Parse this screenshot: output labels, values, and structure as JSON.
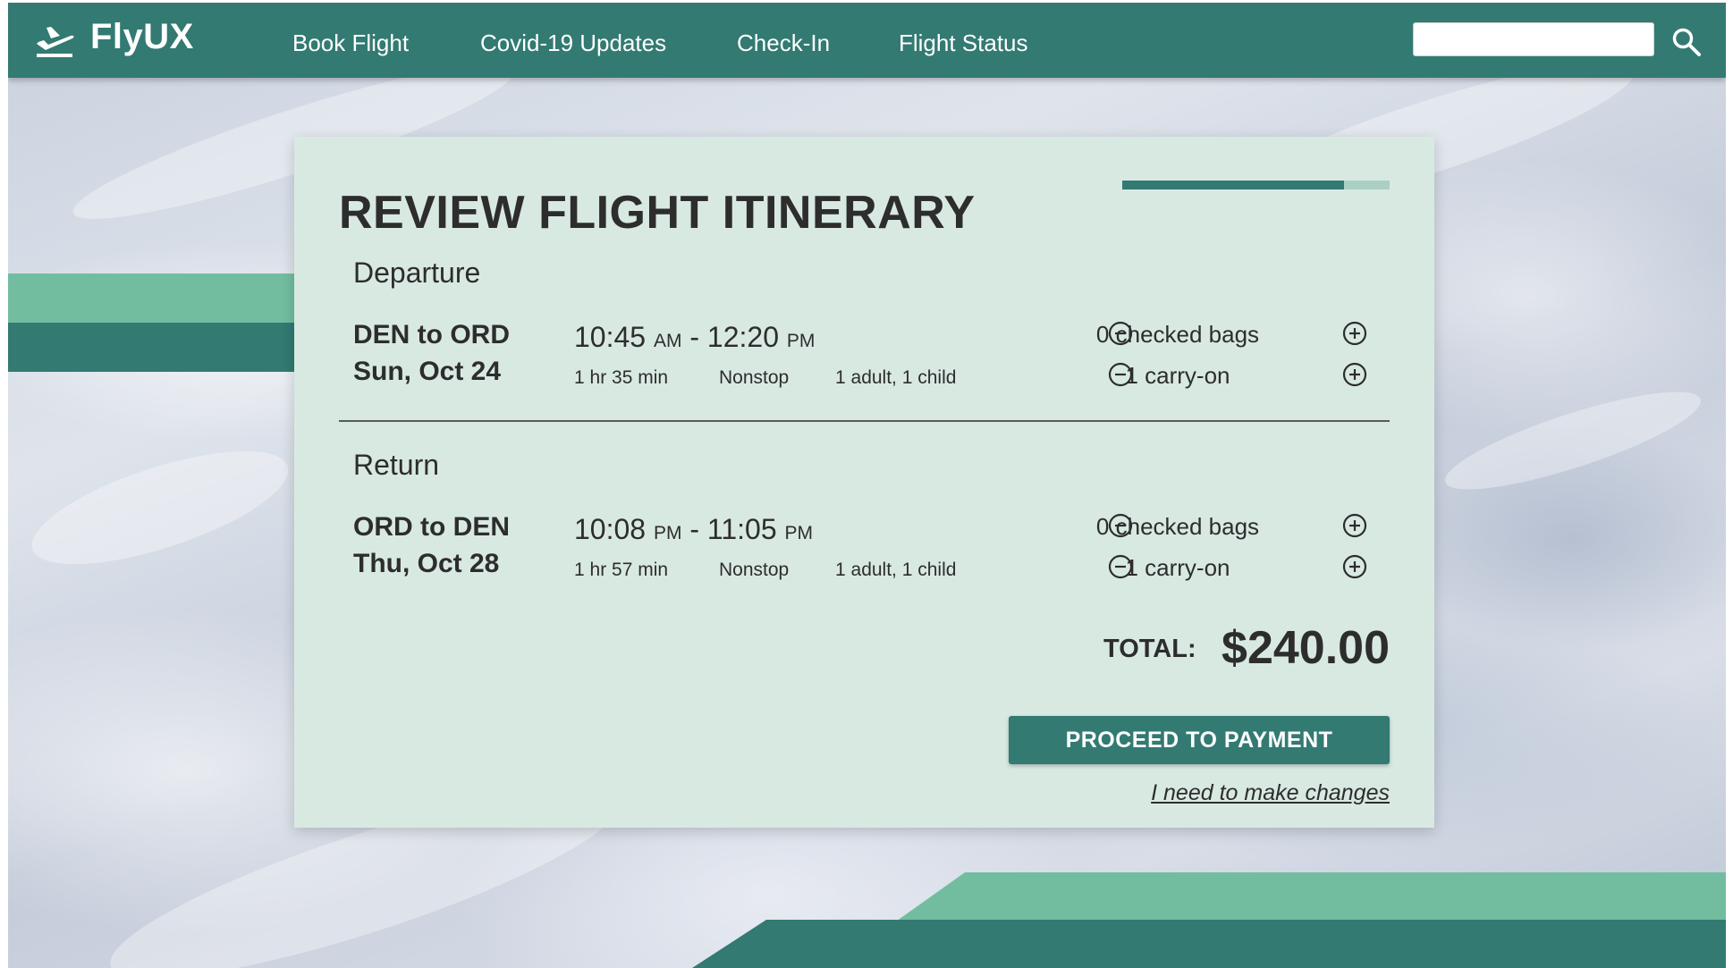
{
  "brand": {
    "name": "FlyUX",
    "icon": "airplane-departure-icon"
  },
  "nav": {
    "links": [
      "Book Flight",
      "Covid-19 Updates",
      "Check-In",
      "Flight Status"
    ],
    "search_value": "",
    "search_icon": "magnifier-icon"
  },
  "colors": {
    "primary": "#327a72",
    "accent": "#72bda0",
    "card_bg": "#d8e9e2",
    "text": "#2d2d2d"
  },
  "itinerary": {
    "title": "REVIEW FLIGHT ITINERARY",
    "progress_fraction": 0.83,
    "departure": {
      "label": "Departure",
      "route": "DEN to ORD",
      "date": "Sun, Oct 24",
      "depart_time": "10:45",
      "depart_ampm": "AM",
      "arrive_time": "12:20",
      "arrive_ampm": "PM",
      "duration": "1 hr 35 min",
      "stops": "Nonstop",
      "passengers": "1 adult, 1 child",
      "checked_bags": "0 checked bags",
      "carry_on": "1 carry-on"
    },
    "return": {
      "label": "Return",
      "route": "ORD to DEN",
      "date": "Thu, Oct 28",
      "depart_time": "10:08",
      "depart_ampm": "PM",
      "arrive_time": "11:05",
      "arrive_ampm": "PM",
      "duration": "1 hr 57 min",
      "stops": "Nonstop",
      "passengers": "1 adult, 1 child",
      "checked_bags": "0 checked bags",
      "carry_on": "1 carry-on"
    },
    "total_label": "TOTAL:",
    "total_value": "$240.00",
    "proceed_label": "PROCEED TO PAYMENT",
    "changes_label": "I need to make changes"
  }
}
